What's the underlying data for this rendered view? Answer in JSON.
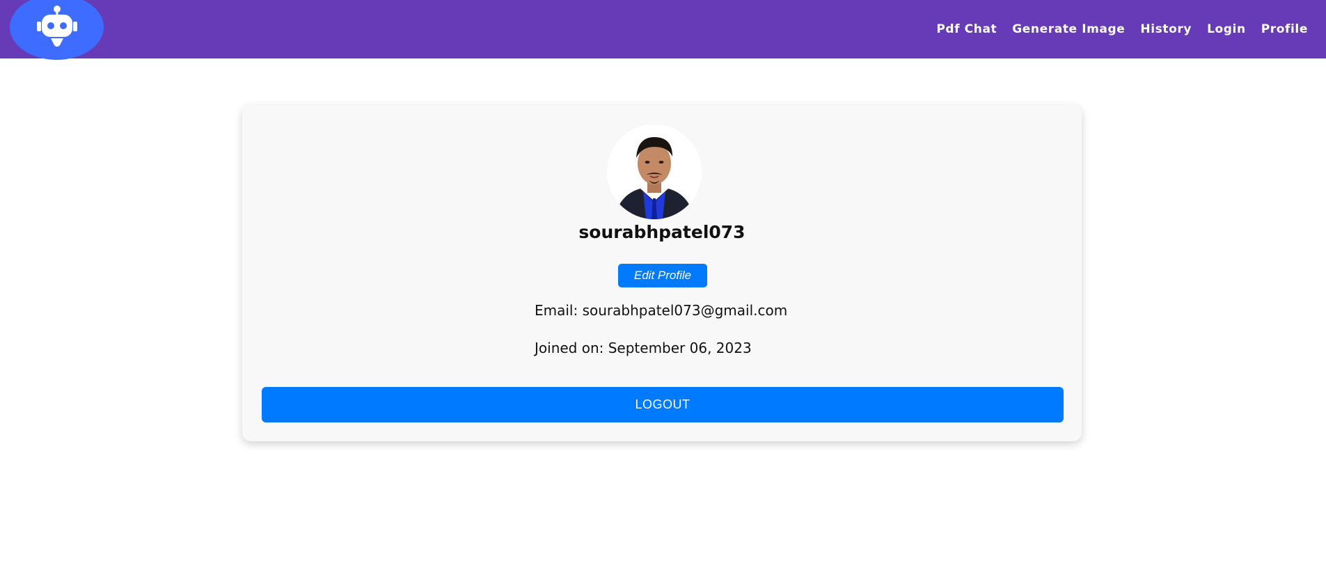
{
  "nav": {
    "links": [
      {
        "label": "Pdf Chat"
      },
      {
        "label": "Generate Image"
      },
      {
        "label": "History"
      },
      {
        "label": "Login"
      },
      {
        "label": "Profile"
      }
    ]
  },
  "logo": {
    "icon": "robot-icon"
  },
  "profile": {
    "username": "sourabhpatel073",
    "edit_label": "Edit Profile",
    "email_text": "Email: sourabhpatel073@gmail.com",
    "joined_text": "Joined on: September 06, 2023",
    "logout_label": "LOGOUT"
  },
  "colors": {
    "navbar": "#673ab7",
    "logo_bg": "#3d6cff",
    "primary_button": "#007bff",
    "card_bg": "#f8f8f8"
  }
}
